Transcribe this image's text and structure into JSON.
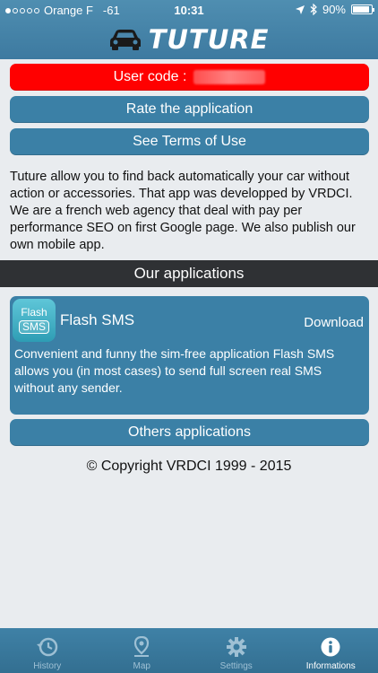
{
  "status_bar": {
    "carrier": "Orange F",
    "signal": "-61",
    "time": "10:31",
    "battery": "90%",
    "battery_level": 0.9
  },
  "header": {
    "title": "TUTURE"
  },
  "buttons": {
    "user_code_label": "User code :",
    "rate": "Rate the application",
    "terms": "See Terms of Use",
    "others": "Others applications"
  },
  "about_text": "Tuture allow you to find back automatically your car without action or accessories. That app was developped by VRDCI. We are a french web agency that deal with pay per performance SEO on first Google page. We also publish our own mobile app.",
  "section_title": "Our applications",
  "app_card": {
    "icon_line1": "Flash",
    "icon_line2": "SMS",
    "name": "Flash SMS",
    "download": "Download",
    "description": "Convenient and funny the sim-free application Flash SMS allows you (in most cases) to send full screen real SMS without any sender."
  },
  "copyright": "© Copyright VRDCI 1999 - 2015",
  "tabs": [
    {
      "label": "History",
      "icon": "history-icon"
    },
    {
      "label": "Map",
      "icon": "map-pin-icon"
    },
    {
      "label": "Settings",
      "icon": "gear-icon"
    },
    {
      "label": "Informations",
      "icon": "info-icon"
    }
  ],
  "colors": {
    "accent": "#3b80a6",
    "alert": "#ff0000",
    "section_bar": "#2f3134"
  }
}
